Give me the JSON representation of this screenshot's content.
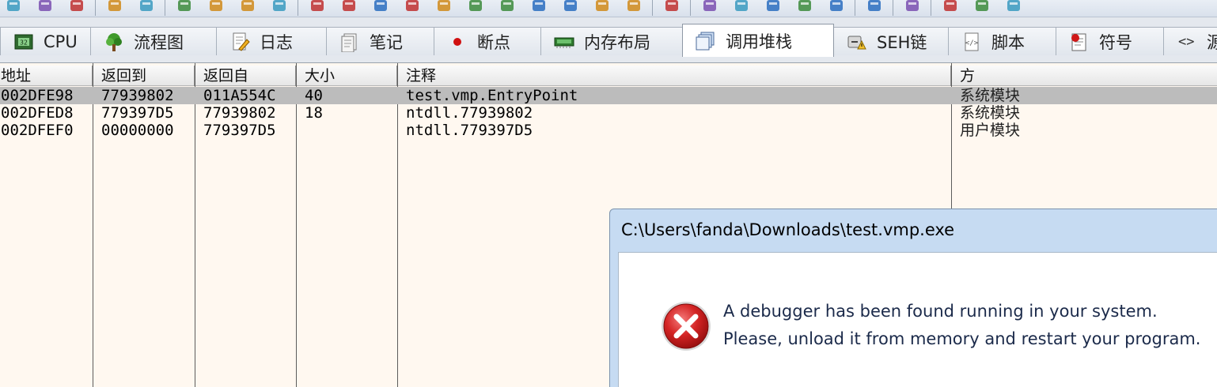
{
  "toolbar": {
    "icons": [
      "open-icon",
      "restart-icon",
      "stop-icon",
      "run-icon",
      "pause-icon",
      "step-into-icon",
      "step-over-icon",
      "step-out-icon",
      "run-to-user-icon",
      "cpu-chip-icon",
      "notepad-icon",
      "breakpoint-icon",
      "memory-icon",
      "window-icon",
      "patch-icon",
      "script-icon",
      "bookmark-icon",
      "code-icon",
      "find-icon",
      "trace-icon",
      "s-icon",
      "bandage-icon",
      "align-icon",
      "link-icon",
      "pen-icon",
      "function-icon",
      "font-icon",
      "bottom-icon",
      "calculator-icon",
      "globe-icon",
      "device-icon"
    ]
  },
  "tabs": [
    {
      "label": "CPU",
      "icon": "cpu-icon",
      "active": false
    },
    {
      "label": "流程图",
      "icon": "tree-icon",
      "active": false
    },
    {
      "label": "日志",
      "icon": "log-icon",
      "active": false
    },
    {
      "label": "笔记",
      "icon": "notes-icon",
      "active": false
    },
    {
      "label": "断点",
      "icon": "breakpoint-dot-icon",
      "active": false
    },
    {
      "label": "内存布局",
      "icon": "memory-map-icon",
      "active": false
    },
    {
      "label": "调用堆栈",
      "icon": "call-stack-icon",
      "active": true
    },
    {
      "label": "SEH链",
      "icon": "seh-chain-icon",
      "active": false
    },
    {
      "label": "脚本",
      "icon": "script-tab-icon",
      "active": false
    },
    {
      "label": "符号",
      "icon": "symbol-icon",
      "active": false
    },
    {
      "label": "源",
      "icon": "source-icon",
      "active": false
    }
  ],
  "grid": {
    "columns": [
      "地址",
      "返回到",
      "返回自",
      "大小",
      "注释",
      "方"
    ],
    "rows": [
      {
        "address": "002DFE98",
        "return_to": "77939802",
        "return_from": "011A554C",
        "size": "40",
        "comment": "test.vmp.EntryPoint",
        "party": "系统模块",
        "selected": true
      },
      {
        "address": "002DFED8",
        "return_to": "779397D5",
        "return_from": "77939802",
        "size": "18",
        "comment": "ntdll.77939802",
        "party": "系统模块",
        "selected": false
      },
      {
        "address": "002DFEF0",
        "return_to": "00000000",
        "return_from": "779397D5",
        "size": "",
        "comment": "ntdll.779397D5",
        "party": "用户模块",
        "selected": false
      }
    ]
  },
  "message_box": {
    "title": "C:\\Users\\fanda\\Downloads\\test.vmp.exe",
    "icon": "error-icon",
    "line1": "A debugger has been found running in your system.",
    "line2": "Please, unload it from memory and restart your program."
  },
  "colors": {
    "grid_background": "#fff8f0",
    "selected_row": "#bcbcbc",
    "dialog_frame": "#c6dbf2",
    "error_red": "#d42424"
  }
}
